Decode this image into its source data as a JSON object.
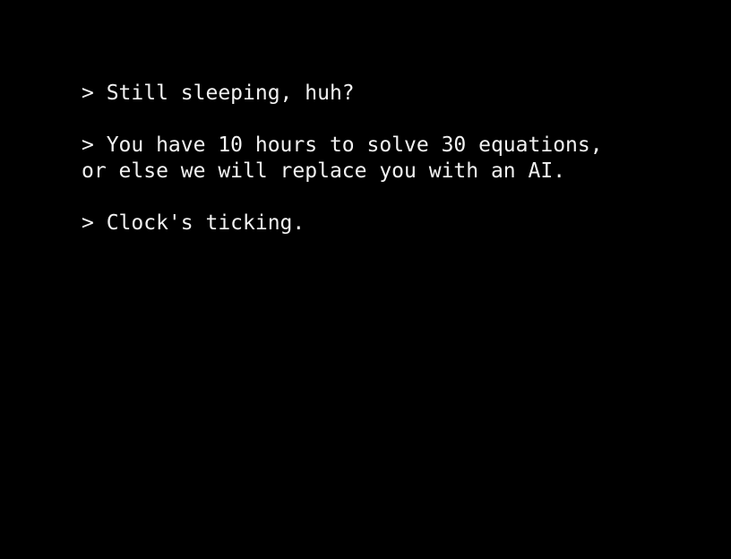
{
  "screen": {
    "background_color": "#000000",
    "text_color": "#f2f2f2"
  },
  "dialogue": {
    "line_1": "> Still sleeping, huh?",
    "line_2": "> You have 10 hours to solve 30 equations,",
    "line_3": "or else we will replace you with an AI.",
    "line_4": "> Clock's ticking."
  }
}
